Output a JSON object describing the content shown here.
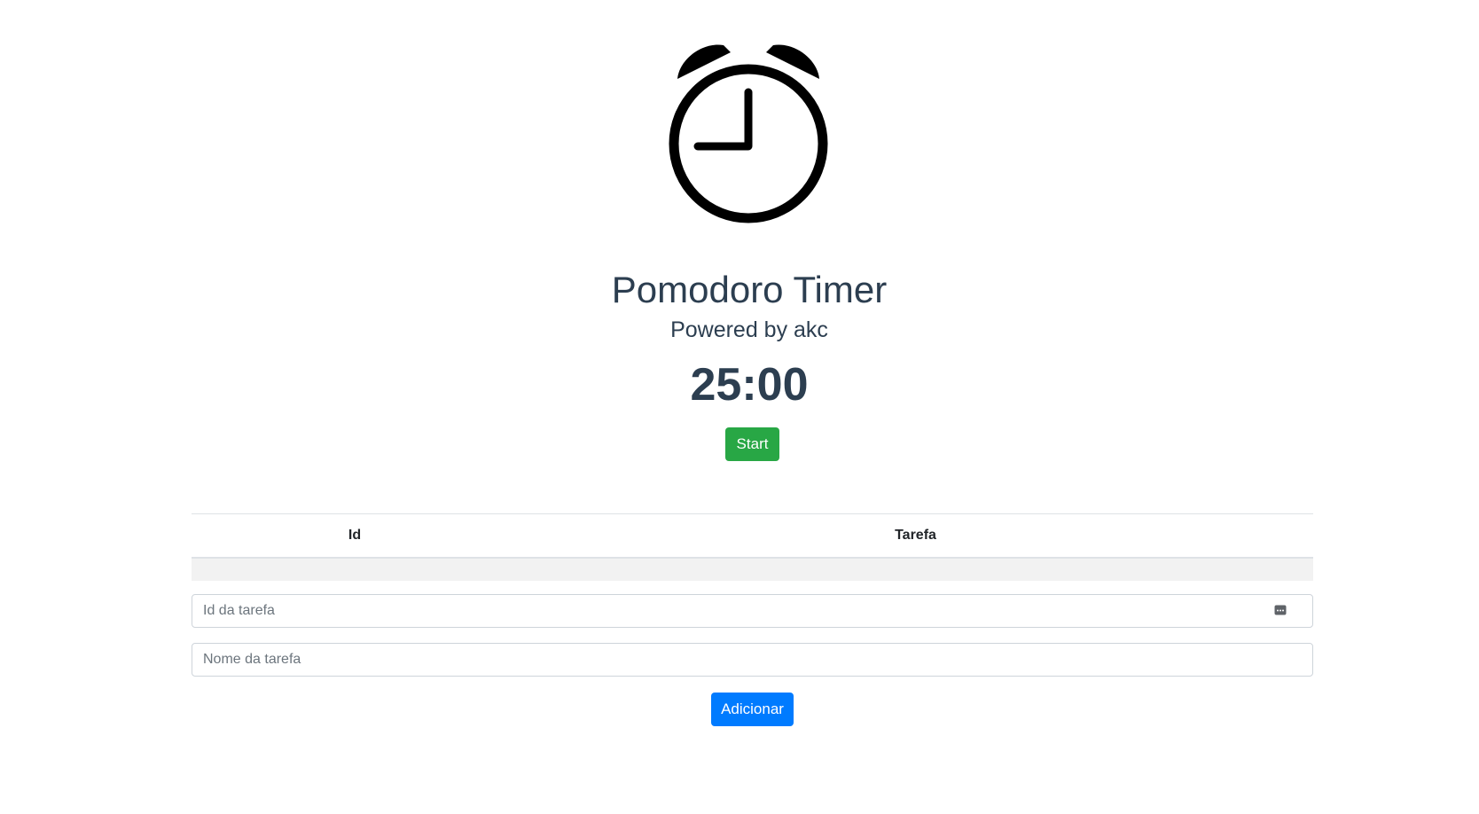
{
  "header": {
    "logo_icon": "alarm-clock-icon",
    "title": "Pomodoro Timer",
    "subtitle": "Powered by akc",
    "timer": "25:00"
  },
  "controls": {
    "start_label": "Start",
    "start_color": "#28a745"
  },
  "table": {
    "columns": [
      "Id",
      "Tarefa"
    ],
    "rows": []
  },
  "form": {
    "id_placeholder": "Id da tarefa",
    "id_value": "",
    "name_placeholder": "Nome da tarefa",
    "name_value": "",
    "add_label": "Adicionar",
    "add_color": "#007bff"
  }
}
